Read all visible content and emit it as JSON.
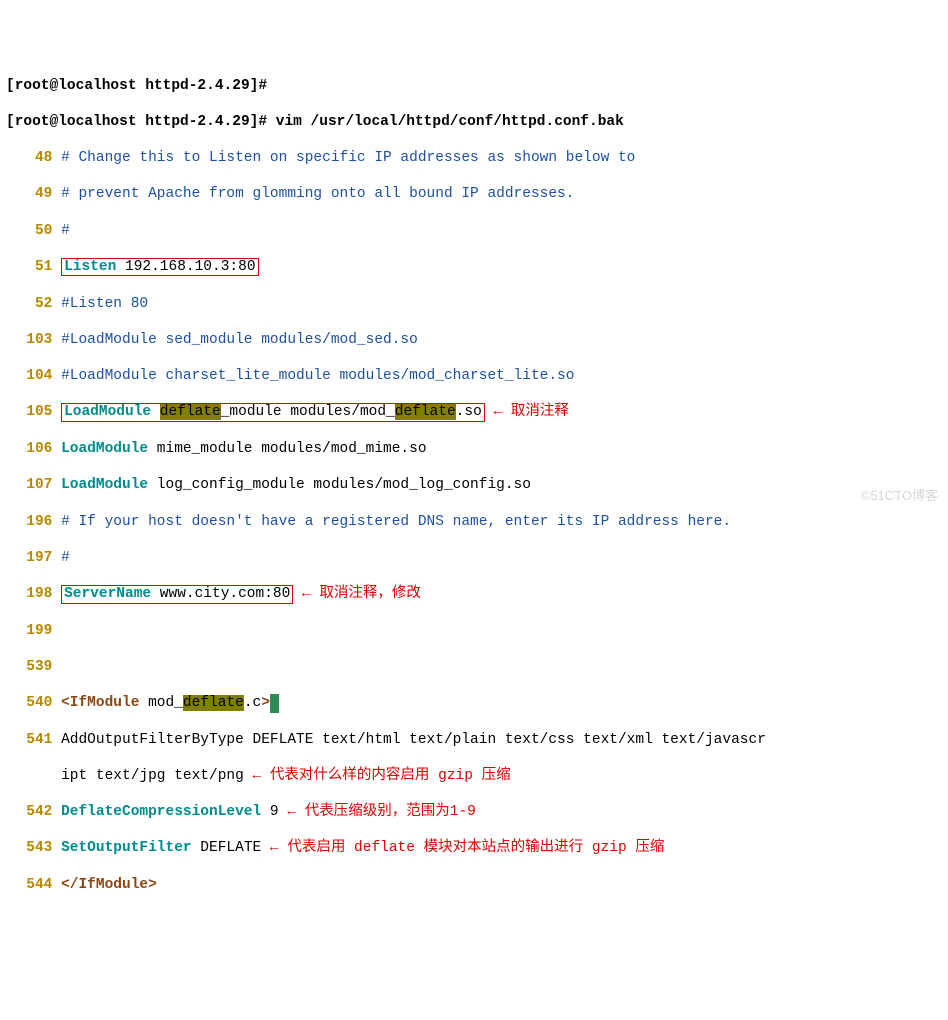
{
  "prompt1": "[root@localhost httpd-2.4.29]#",
  "prompt2": "[root@localhost httpd-2.4.29]# vim /usr/local/httpd/conf/httpd.conf.bak",
  "lines": {
    "n48": "48",
    "l48": "# Change this to Listen on specific IP addresses as shown below to",
    "n49": "49",
    "l49": "# prevent Apache from glomming onto all bound IP addresses.",
    "n50": "50",
    "l50": "#",
    "n51": "51",
    "l51a": "Listen",
    "l51b": " 192.168.10.3:80",
    "n52": "52",
    "l52": "#Listen 80",
    "n103": "103",
    "l103": "#LoadModule sed_module modules/mod_sed.so",
    "n104": "104",
    "l104": "#LoadModule charset_lite_module modules/mod_charset_lite.so",
    "n105": "105",
    "l105a": "LoadModule",
    "l105b": " ",
    "l105c": "deflate",
    "l105d": "_module modules/mod_",
    "l105e": "deflate",
    "l105f": ".so",
    "n105_arrow": " ← ",
    "n105_note": "取消注释",
    "n106": "106",
    "l106a": "LoadModule",
    "l106b": " mime_module modules/mod_mime.so",
    "n107": "107",
    "l107a": "LoadModule",
    "l107b": " log_config_module modules/mod_log_config.so",
    "n196": "196",
    "l196": "# If your host doesn't have a registered DNS name, enter its IP address here.",
    "n197": "197",
    "l197": "#",
    "n198": "198",
    "l198a": "ServerName",
    "l198b": " www.city.com:80",
    "n198_arrow": " ← ",
    "n198_note": "取消注释，修改",
    "n199": "199",
    "n539": "539",
    "n540": "540",
    "l540a": "<IfModule",
    "l540b": " mod_",
    "l540c": "deflate",
    "l540d": ".c",
    "l540e": ">",
    "n541": "541",
    "l541": "AddOutputFilterByType DEFLATE text/html text/plain text/css text/xml text/javascr",
    "l541w": "ipt text/jpg text/png",
    "n541_arrow": " ← ",
    "n541_note": "代表对什么样的内容启用 gzip 压缩",
    "n542": "542",
    "l542a": "DeflateCompressionLevel",
    "l542b": " 9",
    "n542_arrow": " ← ",
    "n542_note": "代表压缩级别，范围为1-9",
    "n543": "543",
    "l543a": "SetOutputFilter",
    "l543b": " DEFLATE",
    "n543_arrow": " ← ",
    "n543_note": "代表启用 deflate 模块对本站点的输出进行 gzip 压缩",
    "n544": "544",
    "l544": "</IfModule>"
  },
  "watermark": "©51CTO博客"
}
